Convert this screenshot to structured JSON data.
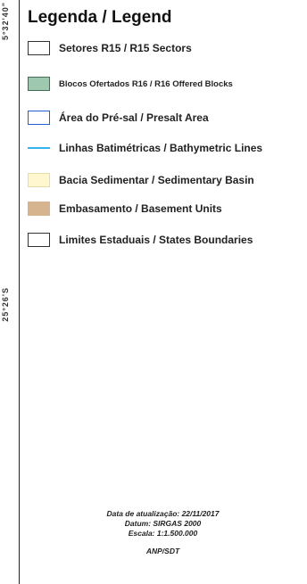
{
  "coords": {
    "top": "5°32'40\"",
    "middle": "25°26'S"
  },
  "legend": {
    "title": "Legenda / Legend",
    "items": [
      {
        "label": "Setores R15 / R15 Sectors",
        "swatch": "box"
      },
      {
        "label": "Blocos Ofertados R16 / R16 Offered Blocks",
        "swatch": "green",
        "color": "#9fc8b0"
      },
      {
        "label": "Área do Pré-sal / Presalt Area",
        "swatch": "blue-outline",
        "color": "#2060d0"
      },
      {
        "label": "Linhas Batimétricas / Bathymetric Lines",
        "swatch": "line",
        "color": "#33b4f0"
      },
      {
        "label": "Bacia Sedimentar / Sedimentary Basin",
        "swatch": "cream",
        "color": "#fff7cf"
      },
      {
        "label": "Embasamento / Basement Units",
        "swatch": "tan",
        "color": "#d6b48f"
      },
      {
        "label": "Limites Estaduais / States Boundaries",
        "swatch": "box"
      }
    ]
  },
  "footer": {
    "update_date": "Data de atualização: 22/11/2017",
    "datum": "Datum: SIRGAS 2000",
    "scale": "Escala: 1:1.500.000",
    "agency": "ANP/SDT"
  }
}
